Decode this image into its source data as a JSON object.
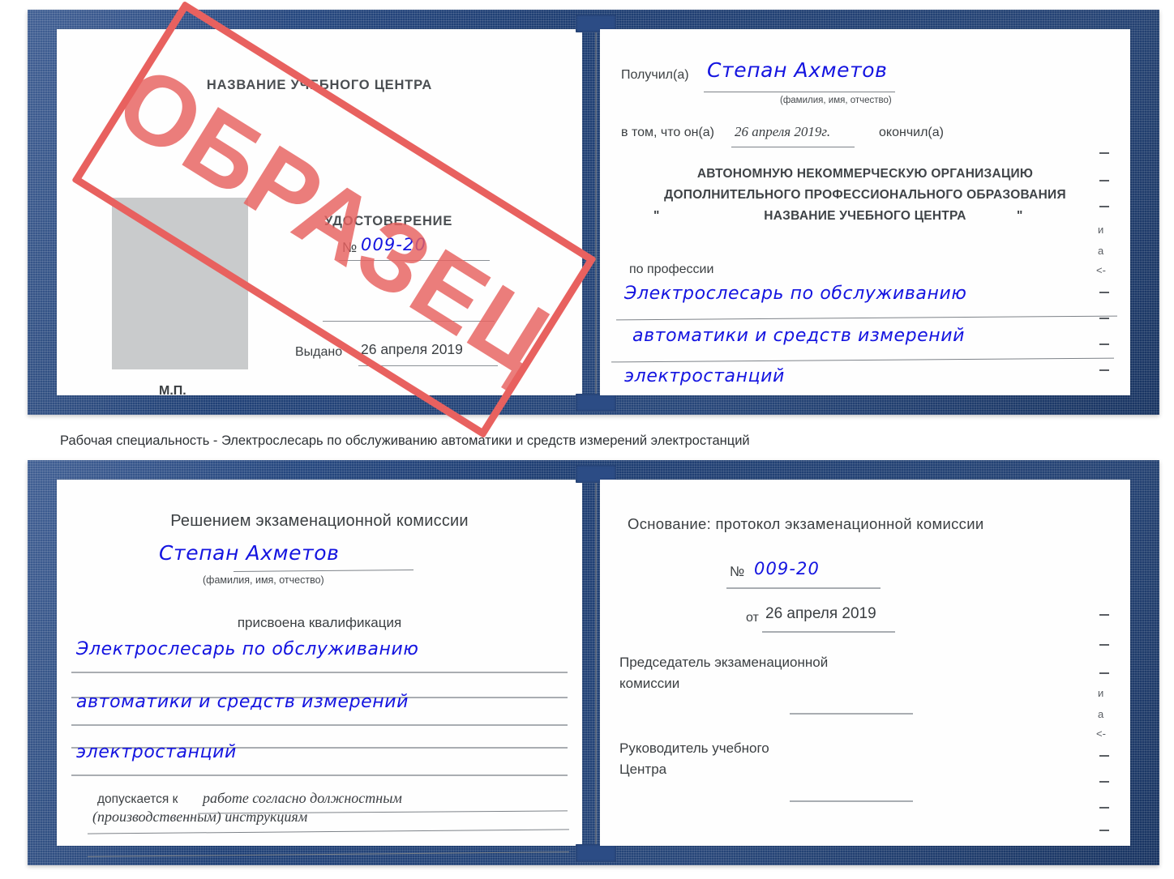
{
  "document_top": {
    "left_page": {
      "center_title": "НАЗВАНИЕ УЧЕБНОГО ЦЕНТРА",
      "doc_type": "УДОСТОВЕРЕНИЕ",
      "number_label": "№",
      "number_value": "009-20",
      "issued_label": "Выдано",
      "issued_value": "26 апреля 2019",
      "seal_label": "М.П.",
      "photo_placeholder": "photo-area"
    },
    "right_page": {
      "received_label": "Получил(а)",
      "received_value": "Степан Ахметов",
      "fio_hint": "(фамилия, имя, отчество)",
      "that_he_label": "в том, что он(а)",
      "that_he_value": "26 апреля 2019г.",
      "finished_label": "окончил(а)",
      "org_line1": "АВТОНОМНУЮ НЕКОММЕРЧЕСКУЮ ОРГАНИЗАЦИЮ",
      "org_line2": "ДОПОЛНИТЕЛЬНОГО ПРОФЕССИОНАЛЬНОГО ОБРАЗОВАНИЯ",
      "org_quote_open": "\"",
      "org_name": "НАЗВАНИЕ УЧЕБНОГО ЦЕНТРА",
      "org_quote_close": "\"",
      "profession_label": "по профессии",
      "profession_line1": "Электрослесарь по обслуживанию",
      "profession_line2": "автоматики и средств измерений",
      "profession_line3": "электростанций",
      "edge_fragments": [
        "и",
        "а",
        "<-"
      ]
    }
  },
  "caption": {
    "text": "Рабочая специальность - Электрослесарь по обслуживанию автоматики и средств измерений электростанций"
  },
  "document_bottom": {
    "left_page": {
      "decision_title": "Решением экзаменационной комиссии",
      "name_value": "Степан Ахметов",
      "fio_hint": "(фамилия, имя, отчество)",
      "qualification_label": "присвоена квалификация",
      "qualification_line1": "Электрослесарь по обслуживанию",
      "qualification_line2": "автоматики и средств измерений",
      "qualification_line3": "электростанций",
      "admitted_label": "допускается к",
      "admitted_value_line1": "работе согласно должностным",
      "admitted_value_line2": "(производственным) инструкциям"
    },
    "right_page": {
      "basis_label": "Основание: протокол экзаменационной комиссии",
      "number_label": "№",
      "number_value": "009-20",
      "date_label": "от",
      "date_value": "26 апреля 2019",
      "chairman_line1": "Председатель экзаменационной",
      "chairman_line2": "комиссии",
      "head_line1": "Руководитель учебного",
      "head_line2": "Центра",
      "edge_fragments": [
        "и",
        "а",
        "<-"
      ]
    }
  },
  "stamp": {
    "text": "ОБРАЗЕЦ",
    "color": "#e8615f",
    "rotation_deg": 32
  },
  "colors": {
    "cover_blue": "#23437b",
    "ink_blue": "#1414e0",
    "stamp_red": "#e8615f",
    "photo_gray": "#c9cbcc",
    "rule_gray": "#8b9096",
    "text_gray": "#3b3f42"
  }
}
